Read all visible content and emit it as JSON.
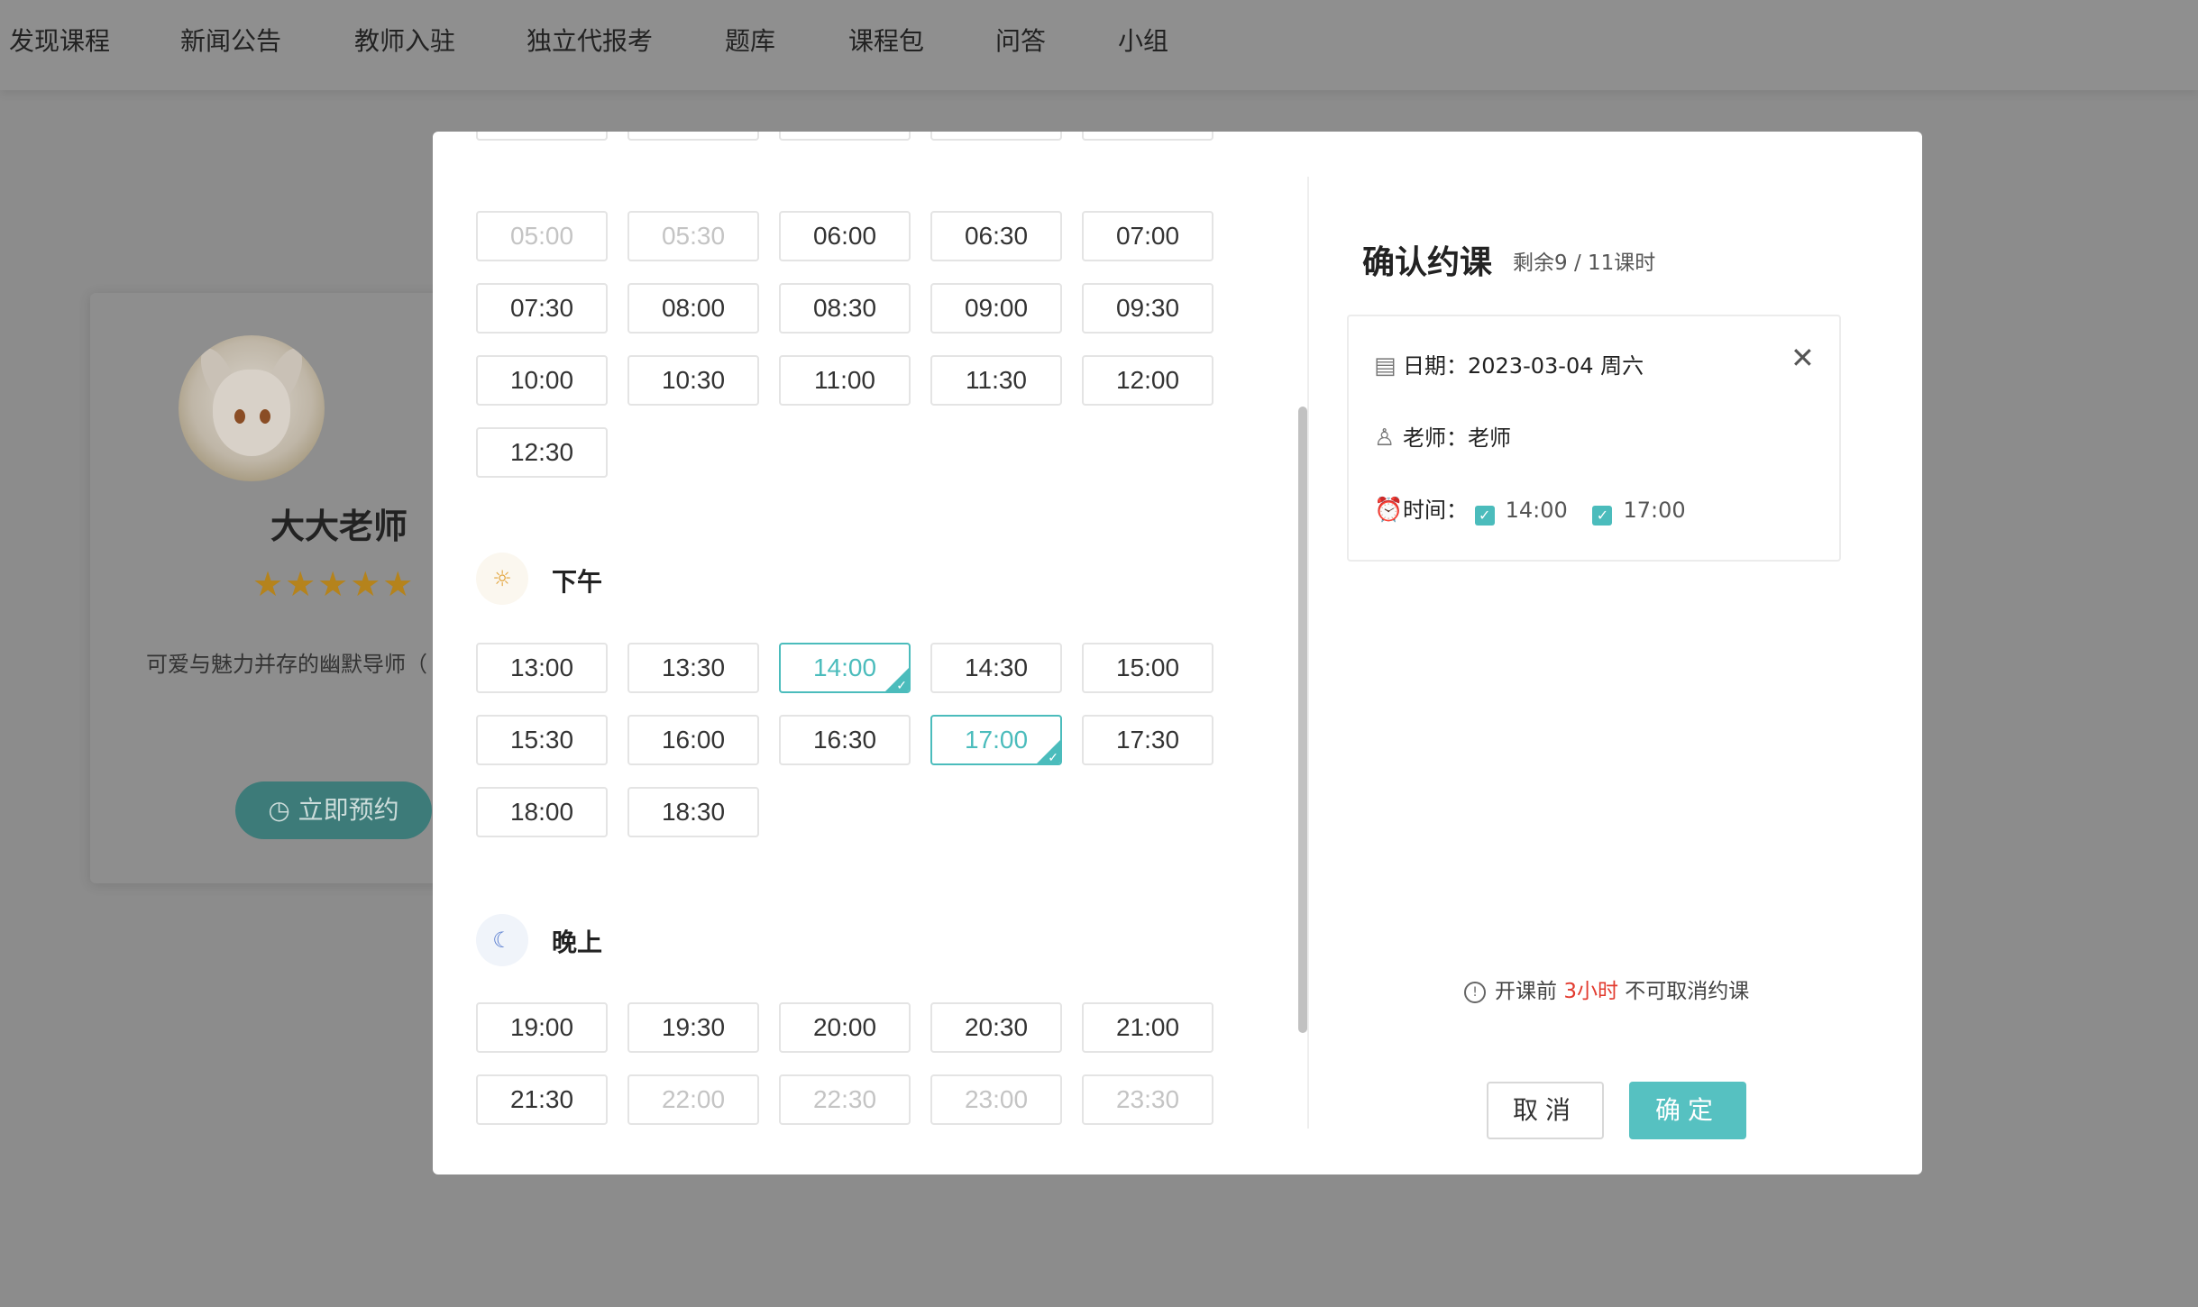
{
  "nav": [
    "发现课程",
    "新闻公告",
    "教师入驻",
    "独立代报考",
    "题库",
    "课程包",
    "问答",
    "小组"
  ],
  "teacher": {
    "name": "大大老师",
    "stars": "★★★★★",
    "intro": "可爱与魅力并存的幽默导师（",
    "book_label": "立即预约"
  },
  "slots": {
    "morning": [
      {
        "time": "05:00",
        "state": "disabled"
      },
      {
        "time": "05:30",
        "state": "disabled"
      },
      {
        "time": "06:00",
        "state": "available"
      },
      {
        "time": "06:30",
        "state": "available"
      },
      {
        "time": "07:00",
        "state": "available"
      },
      {
        "time": "07:30",
        "state": "available"
      },
      {
        "time": "08:00",
        "state": "available"
      },
      {
        "time": "08:30",
        "state": "available"
      },
      {
        "time": "09:00",
        "state": "available"
      },
      {
        "time": "09:30",
        "state": "available"
      },
      {
        "time": "10:00",
        "state": "available"
      },
      {
        "time": "10:30",
        "state": "available"
      },
      {
        "time": "11:00",
        "state": "available"
      },
      {
        "time": "11:30",
        "state": "available"
      },
      {
        "time": "12:00",
        "state": "available"
      },
      {
        "time": "12:30",
        "state": "available"
      }
    ],
    "afternoon_label": "下午",
    "afternoon": [
      {
        "time": "13:00",
        "state": "available"
      },
      {
        "time": "13:30",
        "state": "available"
      },
      {
        "time": "14:00",
        "state": "selected"
      },
      {
        "time": "14:30",
        "state": "available"
      },
      {
        "time": "15:00",
        "state": "available"
      },
      {
        "time": "15:30",
        "state": "available"
      },
      {
        "time": "16:00",
        "state": "available"
      },
      {
        "time": "16:30",
        "state": "available"
      },
      {
        "time": "17:00",
        "state": "selected"
      },
      {
        "time": "17:30",
        "state": "available"
      },
      {
        "time": "18:00",
        "state": "available"
      },
      {
        "time": "18:30",
        "state": "available"
      }
    ],
    "evening_label": "晚上",
    "evening": [
      {
        "time": "19:00",
        "state": "available"
      },
      {
        "time": "19:30",
        "state": "available"
      },
      {
        "time": "20:00",
        "state": "available"
      },
      {
        "time": "20:30",
        "state": "available"
      },
      {
        "time": "21:00",
        "state": "available"
      },
      {
        "time": "21:30",
        "state": "available"
      },
      {
        "time": "22:00",
        "state": "disabled"
      },
      {
        "time": "22:30",
        "state": "disabled"
      },
      {
        "time": "23:00",
        "state": "disabled"
      },
      {
        "time": "23:30",
        "state": "disabled"
      }
    ]
  },
  "confirm": {
    "title": "确认约课",
    "remaining": "剩余9 / 11课时",
    "date_label": "日期：",
    "date_value": "2023-03-04 周六",
    "teacher_label": "老师：",
    "teacher_value": "老师",
    "time_label": "时间：",
    "times": [
      "14:00",
      "17:00"
    ],
    "notice_prefix": "开课前",
    "notice_highlight": "3小时",
    "notice_suffix": "不可取消约课",
    "cancel_label": "取消",
    "ok_label": "确定"
  },
  "colors": {
    "accent": "#56c1c1",
    "danger": "#e23b2f"
  }
}
